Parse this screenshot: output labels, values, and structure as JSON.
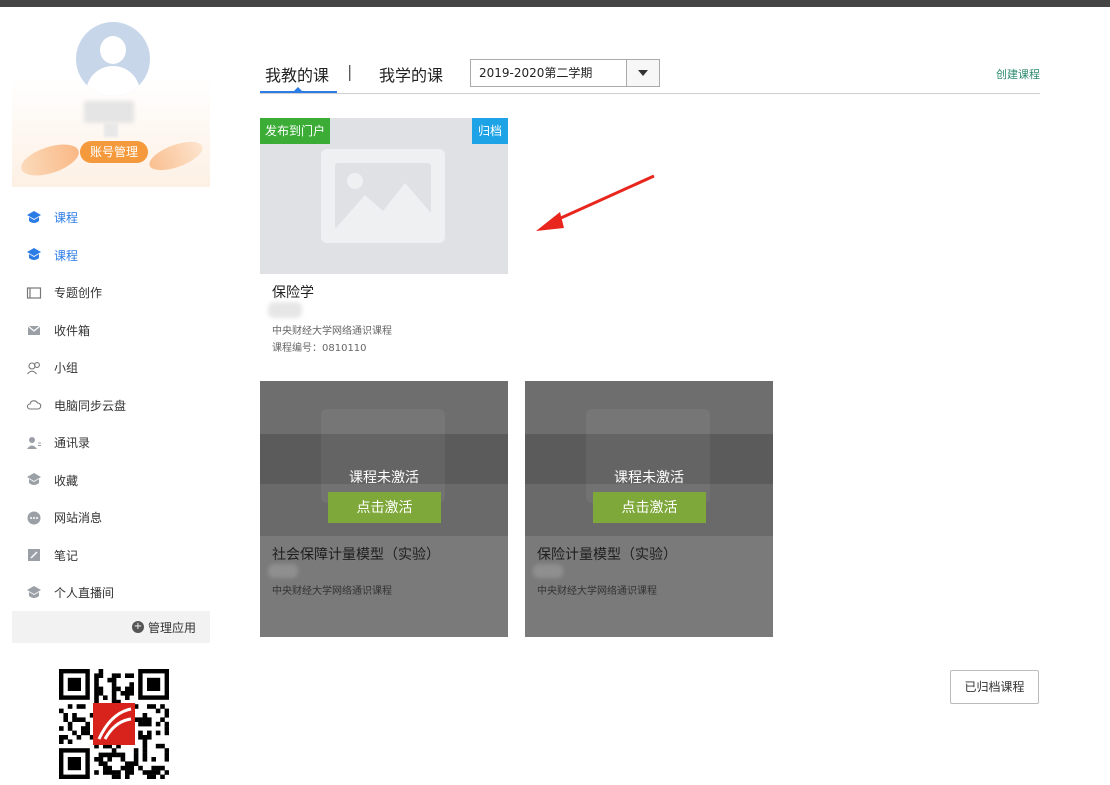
{
  "sidebar": {
    "account_button": "账号管理",
    "nav": [
      {
        "label": "课程",
        "icon": "course-icon",
        "active": true
      },
      {
        "label": "课程",
        "icon": "course-icon",
        "active": true
      },
      {
        "label": "专题创作",
        "icon": "topic-icon",
        "active": false
      },
      {
        "label": "收件箱",
        "icon": "inbox-icon",
        "active": false
      },
      {
        "label": "小组",
        "icon": "group-icon",
        "active": false
      },
      {
        "label": "电脑同步云盘",
        "icon": "cloud-icon",
        "active": false
      },
      {
        "label": "通讯录",
        "icon": "contacts-icon",
        "active": false
      },
      {
        "label": "收藏",
        "icon": "favorite-icon",
        "active": false
      },
      {
        "label": "网站消息",
        "icon": "message-icon",
        "active": false
      },
      {
        "label": "笔记",
        "icon": "note-icon",
        "active": false
      },
      {
        "label": "个人直播间",
        "icon": "live-icon",
        "active": false
      }
    ],
    "manage_apps": "管理应用"
  },
  "header": {
    "tab_teach": "我教的课",
    "tab_separator": "|",
    "tab_learn": "我学的课",
    "semester": "2019-2020第二学期",
    "create_course": "创建课程"
  },
  "courses": [
    {
      "publish_badge": "发布到门户",
      "archive_badge": "归档",
      "title": "保险学",
      "school": "中央财经大学网络通识课程",
      "code": "课程编号：0810110"
    },
    {
      "status": "课程未激活",
      "activate": "点击激活",
      "title": "社会保障计量模型（实验）",
      "school": "中央财经大学网络通识课程"
    },
    {
      "status": "课程未激活",
      "activate": "点击激活",
      "title": "保险计量模型（实验）",
      "school": "中央财经大学网络通识课程"
    }
  ],
  "archived_courses": "已归档课程",
  "colors": {
    "accent": "#2c7ce6",
    "publish": "#3bac36",
    "archive": "#1ea4e6",
    "activate": "#7fa83a",
    "account": "#f59a3c",
    "arrow": "#e8261e"
  }
}
